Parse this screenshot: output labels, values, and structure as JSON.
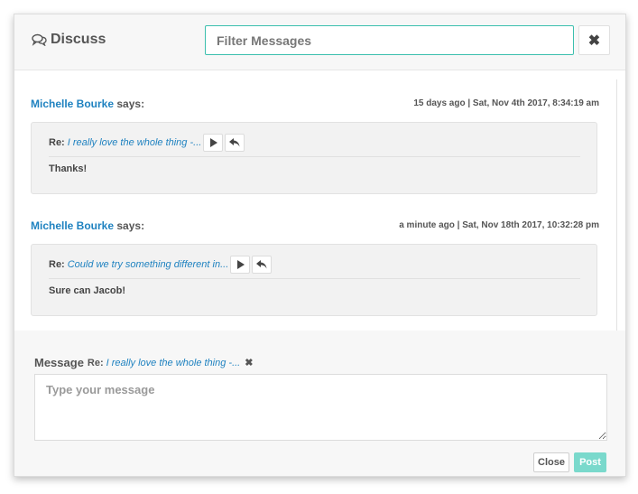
{
  "header": {
    "title": "Discuss",
    "filter_placeholder": "Filter Messages",
    "icons": {
      "title": "comments-icon",
      "close": "close-icon"
    }
  },
  "messages": [
    {
      "author": "Michelle Bourke",
      "says": "says:",
      "timestamp": "15 days ago | Sat, Nov 4th 2017, 8:34:19 am",
      "re_label": "Re:",
      "re_text": "I really love the whole thing -...",
      "body": "Thanks!"
    },
    {
      "author": "Michelle Bourke",
      "says": "says:",
      "timestamp": "a minute ago | Sat, Nov 18th 2017, 10:32:28 pm",
      "re_label": "Re:",
      "re_text": "Could we try something different in...",
      "body": "Sure can Jacob!"
    }
  ],
  "composer": {
    "label": "Message",
    "re_label": "Re:",
    "re_text": "I really love the whole thing -...",
    "placeholder": "Type your message",
    "close_label": "Close",
    "post_label": "Post"
  },
  "colors": {
    "accent": "#3cbfae",
    "link": "#1f82c0",
    "post_button": "#7ad9cc"
  }
}
